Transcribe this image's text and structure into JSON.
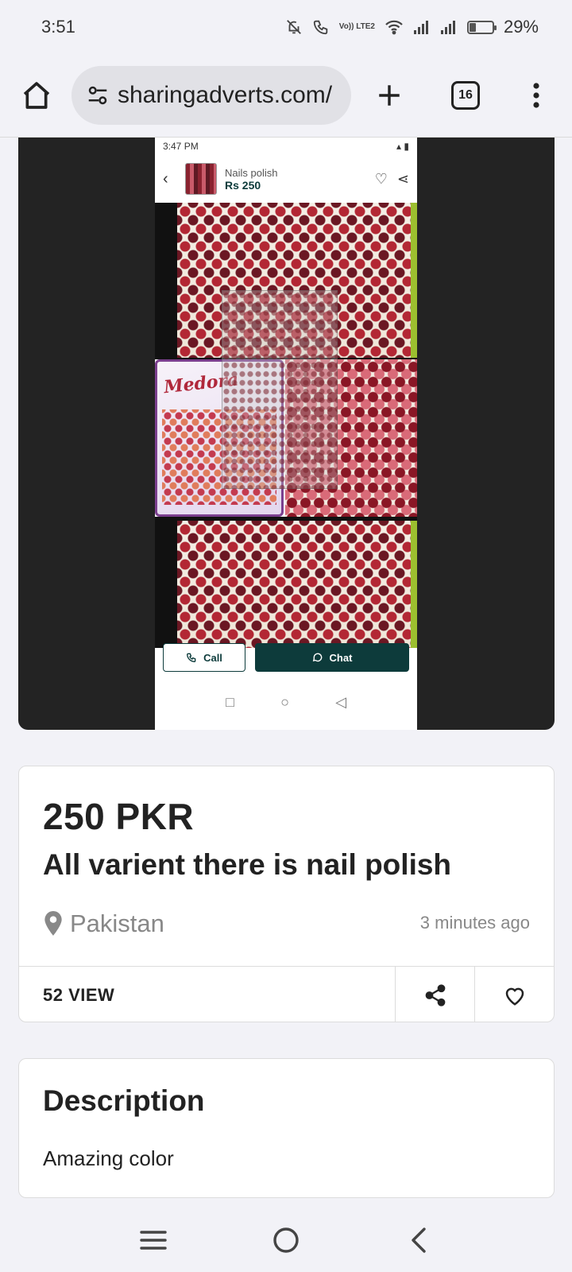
{
  "status_bar": {
    "time": "3:51",
    "lte_label": "Vo)) LTE2",
    "battery_percent_label": "29%",
    "battery_level": 0.29
  },
  "browser": {
    "url": "sharingadverts.com/",
    "tab_count": "16"
  },
  "image_viewer": {
    "inner_status_time": "3:47 PM",
    "inner_item_name": "Nails polish",
    "inner_item_price": "Rs 250",
    "inner_logo_text": "Medora",
    "inner_call_label": "Call",
    "inner_chat_label": "Chat"
  },
  "listing": {
    "price": "250 PKR",
    "title": "All varient there is nail polish",
    "location": "Pakistan",
    "time_ago": "3 minutes ago",
    "views": "52 VIEW"
  },
  "description": {
    "heading": "Description",
    "text": "Amazing color"
  },
  "icons": {
    "home": "home-icon",
    "site_settings": "tune-icon",
    "new_tab": "plus-icon",
    "menu": "more-vert-icon",
    "location": "location-pin-icon",
    "share": "share-icon",
    "favorite": "heart-icon",
    "nav_recents": "menu-lines-icon",
    "nav_home": "circle-home-icon",
    "nav_back": "back-chevron-icon"
  },
  "colors": {
    "accent_dark_teal": "#0d3b3b",
    "page_bg": "#f2f2f7",
    "viewer_bg": "#232323"
  }
}
